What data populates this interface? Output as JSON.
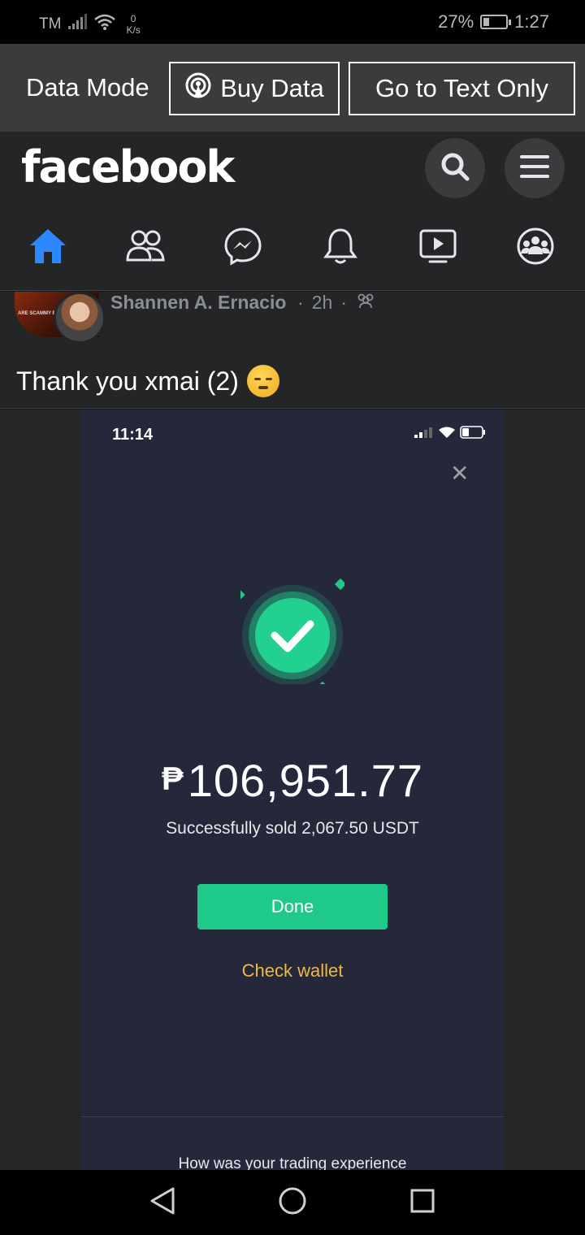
{
  "status_bar": {
    "carrier": "TM",
    "net_speed_value": "0",
    "net_speed_unit": "K/s",
    "battery_percent": "27%",
    "battery_level": 0.27,
    "time": "1:27"
  },
  "data_mode": {
    "label": "Data Mode",
    "buy_data_label": "Buy Data",
    "text_only_label": "Go to Text Only"
  },
  "header": {
    "logo": "facebook",
    "icons": [
      "search-icon",
      "menu-icon"
    ],
    "nav_tabs": [
      "home-icon",
      "friends-icon",
      "messenger-icon",
      "notifications-icon",
      "watch-icon",
      "groups-icon"
    ],
    "active_color": "#2d88ff"
  },
  "post": {
    "author": "Shannen A. Ernacio",
    "time": "2h",
    "separator": "·",
    "page_label": "ARE SCAMMY BU",
    "text": "Thank you xmai (2)",
    "audience_icon": "friends-icon"
  },
  "screenshot": {
    "time": "11:14",
    "amount_currency": "₱",
    "amount": "106,951.77",
    "sold_text": "Successfully sold 2,067.50 USDT",
    "done_label": "Done",
    "check_wallet_label": "Check wallet",
    "feedback_text": "How was your trading experience",
    "accent_green": "#1fc98a",
    "accent_gold": "#f0b93b"
  },
  "nav_bar": {
    "icons": [
      "back-icon",
      "home-circle-icon",
      "recents-icon"
    ]
  }
}
